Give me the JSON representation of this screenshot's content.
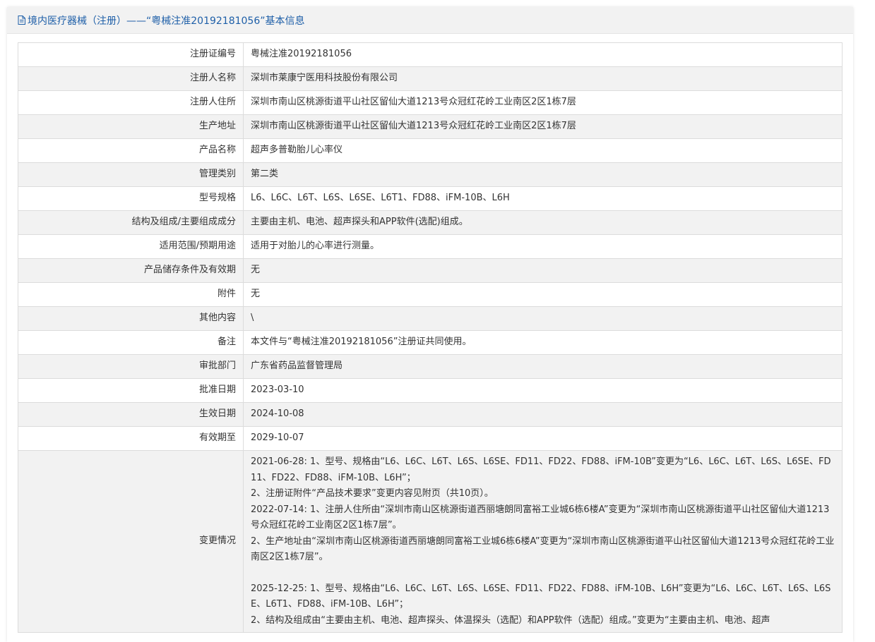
{
  "header": {
    "title": "境内医疗器械（注册）——“粤械注准20192181056”基本信息",
    "icon": "document-icon"
  },
  "rows": [
    {
      "label": "注册证编号",
      "value": "粤械注准20192181056"
    },
    {
      "label": "注册人名称",
      "value": "深圳市莱康宁医用科技股份有限公司"
    },
    {
      "label": "注册人住所",
      "value": "深圳市南山区桃源街道平山社区留仙大道1213号众冠红花岭工业南区2区1栋7层"
    },
    {
      "label": "生产地址",
      "value": "深圳市南山区桃源街道平山社区留仙大道1213号众冠红花岭工业南区2区1栋7层"
    },
    {
      "label": "产品名称",
      "value": "超声多普勒胎儿心率仪"
    },
    {
      "label": "管理类别",
      "value": "第二类"
    },
    {
      "label": "型号规格",
      "value": "L6、L6C、L6T、L6S、L6SE、L6T1、FD88、iFM-10B、L6H"
    },
    {
      "label": "结构及组成/主要组成成分",
      "value": "主要由主机、电池、超声探头和APP软件(选配)组成。"
    },
    {
      "label": "适用范围/预期用途",
      "value": "适用于对胎儿的心率进行测量。"
    },
    {
      "label": "产品储存条件及有效期",
      "value": "无"
    },
    {
      "label": "附件",
      "value": "无"
    },
    {
      "label": "其他内容",
      "value": "\\"
    },
    {
      "label": "备注",
      "value": "本文件与“粤械注准20192181056”注册证共同使用。"
    },
    {
      "label": "审批部门",
      "value": "广东省药品监督管理局"
    },
    {
      "label": "批准日期",
      "value": "2023-03-10"
    },
    {
      "label": "生效日期",
      "value": "2024-10-08"
    },
    {
      "label": "有效期至",
      "value": "2029-10-07"
    }
  ],
  "changes": {
    "label": "变更情况",
    "lines": [
      "2021-06-28: 1、型号、规格由“L6、L6C、L6T、L6S、L6SE、FD11、FD22、FD88、iFM-10B”变更为“L6、L6C、L6T、L6S、L6SE、FD11、FD22、FD88、iFM-10B、L6H”；",
      "2、注册证附件“产品技术要求”变更内容见附页（共10页）。",
      "2022-07-14: 1、注册人住所由“深圳市南山区桃源街道西丽塘朗同富裕工业城6栋6楼A”变更为“深圳市南山区桃源街道平山社区留仙大道1213号众冠红花岭工业南区2区1栋7层”。",
      "2、生产地址由“深圳市南山区桃源街道西丽塘朗同富裕工业城6栋6楼A”变更为“深圳市南山区桃源街道平山社区留仙大道1213号众冠红花岭工业南区2区1栋7层”。",
      "",
      "2025-12-25: 1、型号、规格由“L6、L6C、L6T、L6S、L6SE、FD11、FD22、FD88、iFM-10B、L6H”变更为“L6、L6C、L6T、L6S、L6SE、L6T1、FD88、iFM-10B、L6H”；",
      "2、结构及组成由“主要由主机、电池、超声探头、体温探头（选配）和APP软件（选配）组成。”变更为“主要由主机、电池、超声"
    ]
  }
}
